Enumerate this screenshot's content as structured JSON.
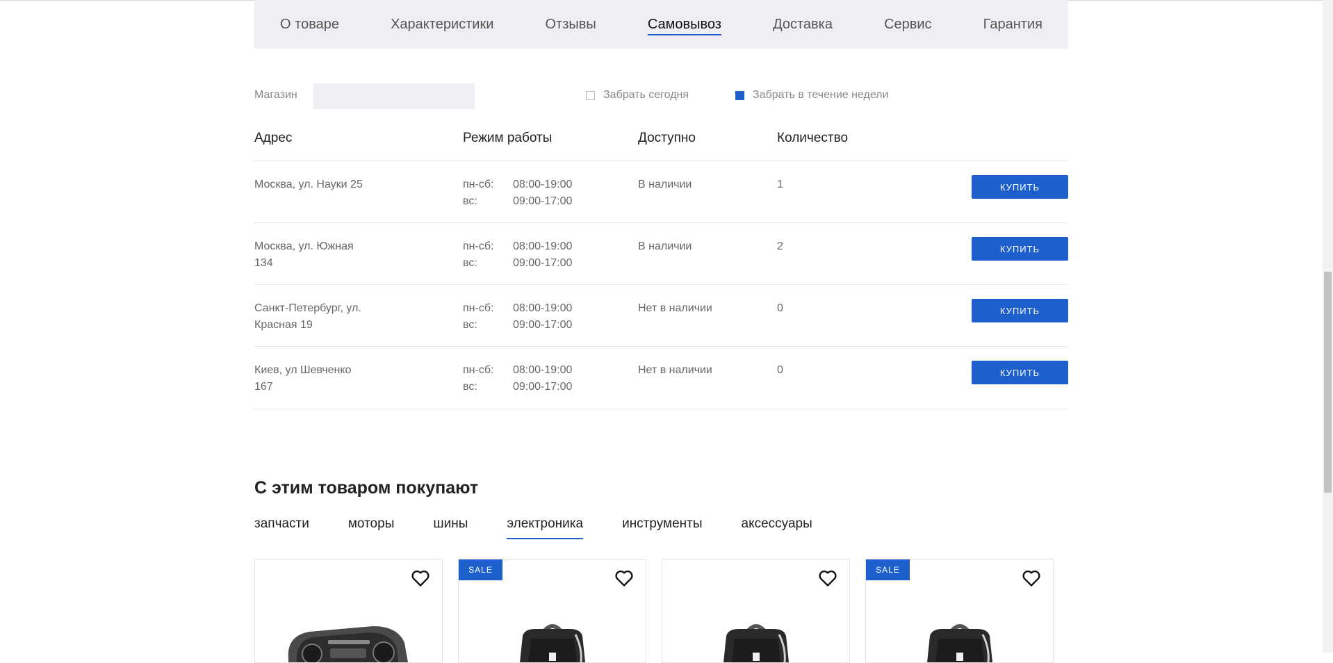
{
  "product_tabs": [
    {
      "label": "О товаре",
      "active": false
    },
    {
      "label": "Характеристики",
      "active": false
    },
    {
      "label": "Отзывы",
      "active": false
    },
    {
      "label": "Самовывоз",
      "active": true
    },
    {
      "label": "Доставка",
      "active": false
    },
    {
      "label": "Сервис",
      "active": false
    },
    {
      "label": "Гарантия",
      "active": false
    }
  ],
  "filter": {
    "store_label": "Магазин",
    "store_value": "",
    "pickup_today_label": "Забрать сегодня",
    "pickup_today_checked": false,
    "pickup_week_label": "Забрать в течение недели",
    "pickup_week_checked": true
  },
  "table": {
    "headers": [
      "Адрес",
      "Режим работы",
      "Доступно",
      "Количество"
    ],
    "buy_label": "КУПИТЬ",
    "rows": [
      {
        "address": "Москва, ул. Науки 25",
        "days_weekday": "пн-сб:",
        "time_weekday": "08:00-19:00",
        "days_weekend": "вс:",
        "time_weekend": "09:00-17:00",
        "availability": "В наличии",
        "quantity": "1"
      },
      {
        "address": "Москва, ул. Южная 134",
        "days_weekday": "пн-сб:",
        "time_weekday": "08:00-19:00",
        "days_weekend": "вс:",
        "time_weekend": "09:00-17:00",
        "availability": "В наличии",
        "quantity": "2"
      },
      {
        "address": "Санкт-Петербург, ул. Красная 19",
        "days_weekday": "пн-сб:",
        "time_weekday": "08:00-19:00",
        "days_weekend": "вс:",
        "time_weekend": "09:00-17:00",
        "availability": "Нет в наличии",
        "quantity": "0"
      },
      {
        "address": "Киев, ул Шевченко 167",
        "days_weekday": "пн-сб:",
        "time_weekday": "08:00-19:00",
        "days_weekend": "вс:",
        "time_weekend": "09:00-17:00",
        "availability": "Нет в наличии",
        "quantity": "0"
      }
    ]
  },
  "related": {
    "title": "С этим товаром покупают",
    "categories": [
      {
        "label": "запчасти",
        "active": false
      },
      {
        "label": "моторы",
        "active": false
      },
      {
        "label": "шины",
        "active": false
      },
      {
        "label": "электроника",
        "active": true
      },
      {
        "label": "инструменты",
        "active": false
      },
      {
        "label": "аксессуары",
        "active": false
      }
    ],
    "cards": [
      {
        "sale": false,
        "sale_label": "",
        "image": "speaker-device"
      },
      {
        "sale": true,
        "sale_label": "SALE",
        "image": "backpack"
      },
      {
        "sale": false,
        "sale_label": "",
        "image": "backpack"
      },
      {
        "sale": true,
        "sale_label": "SALE",
        "image": "backpack"
      }
    ]
  },
  "colors": {
    "accent": "#1c5fcd",
    "tab_bg": "#efeff3"
  },
  "icons": {
    "favorite": "heart-outline-icon"
  }
}
